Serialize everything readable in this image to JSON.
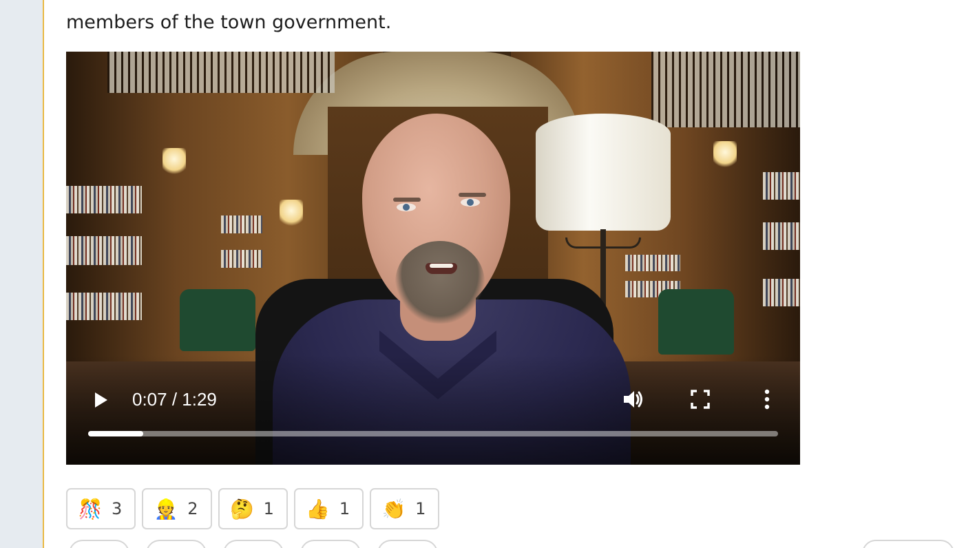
{
  "post": {
    "line1_partial": "                                                                                                                                                                                       ",
    "line2": "members of the town government."
  },
  "video": {
    "time_current": "0:07",
    "time_total": "1:29",
    "time_display": "0:07 / 1:29",
    "progress": 0.08
  },
  "reactions": [
    {
      "emoji": "🎊",
      "icon": "confetti-icon",
      "count": "3"
    },
    {
      "emoji": "👷",
      "icon": "construction-worker-icon",
      "count": "2"
    },
    {
      "emoji": "🤔",
      "icon": "thinking-face-icon",
      "count": "1"
    },
    {
      "emoji": "👍",
      "icon": "thumbs-up-icon",
      "count": "1"
    },
    {
      "emoji": "👏",
      "icon": "clapping-hands-icon",
      "count": "1"
    }
  ],
  "colors": {
    "accent_rule": "#e9b943",
    "gutter": "#e6ebf0",
    "reaction_border": "#d6d6d6"
  }
}
